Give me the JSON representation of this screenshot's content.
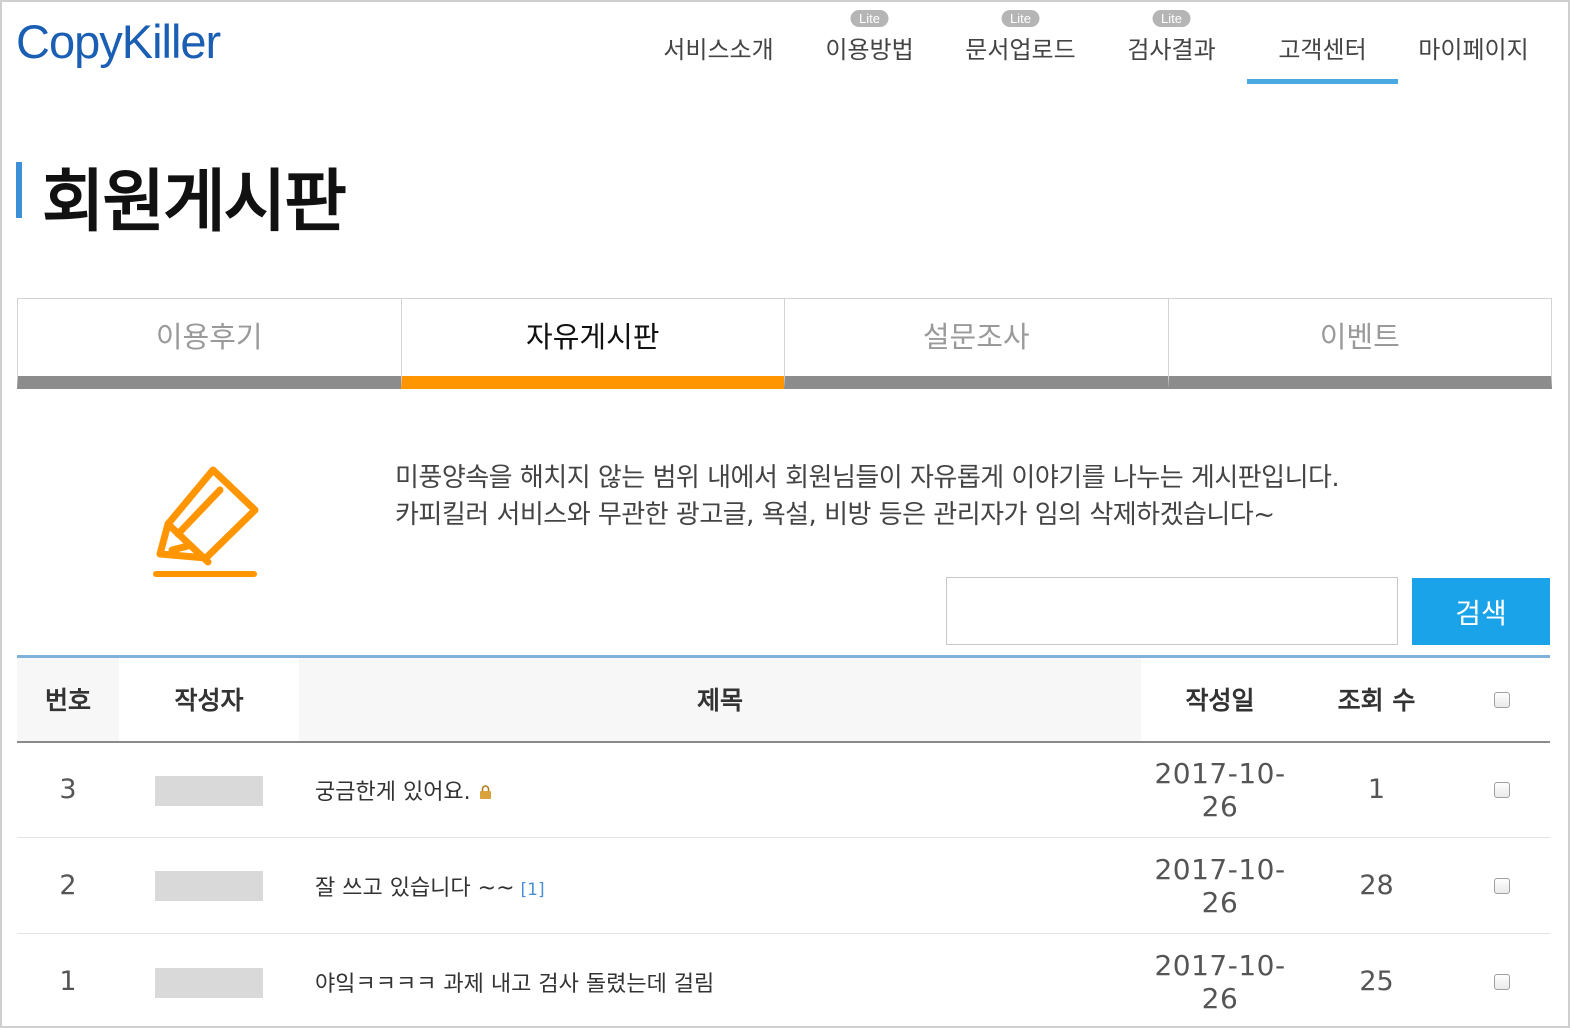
{
  "header": {
    "logo": "CopyKiller",
    "nav": [
      {
        "label": "서비스소개",
        "badge": ""
      },
      {
        "label": "이용방법",
        "badge": "Lite"
      },
      {
        "label": "문서업로드",
        "badge": "Lite"
      },
      {
        "label": "검사결과",
        "badge": "Lite"
      },
      {
        "label": "고객센터",
        "badge": "",
        "active": true
      },
      {
        "label": "마이페이지",
        "badge": ""
      }
    ],
    "accent_color": "#49a9e0"
  },
  "page": {
    "title": "회원게시판"
  },
  "tabs": [
    {
      "label": "이용후기"
    },
    {
      "label": "자유게시판",
      "active": true
    },
    {
      "label": "설문조사"
    },
    {
      "label": "이벤트"
    }
  ],
  "intro": {
    "icon": "pencil-icon",
    "line1": "미풍양속을 해치지 않는 범위 내에서 회원님들이 자유롭게 이야기를 나누는 게시판입니다.",
    "line2": "카피킬러 서비스와 무관한 광고글, 욕설, 비방 등은 관리자가 임의 삭제하겠습니다~"
  },
  "search": {
    "value": "",
    "placeholder": "",
    "button_label": "검색"
  },
  "board": {
    "columns": {
      "no": "번호",
      "author": "작성자",
      "subject": "제목",
      "date": "작성일",
      "views": "조회 수"
    },
    "rows": [
      {
        "no": "3",
        "subject": "궁금한게 있어요.",
        "reply": "",
        "locked": true,
        "date": "2017-10-26",
        "views": "1"
      },
      {
        "no": "2",
        "subject": "잘 쓰고 있습니다 ~~",
        "reply": "[1]",
        "locked": false,
        "date": "2017-10-26",
        "views": "28"
      },
      {
        "no": "1",
        "subject": "야잌ㅋㅋㅋㅋ 과제 내고 검사 돌렸는데 걸림",
        "reply": "",
        "locked": false,
        "date": "2017-10-26",
        "views": "25"
      }
    ]
  },
  "colors": {
    "tab_active": "#ff9500",
    "search_button": "#1aa3e8",
    "title_bar": "#3d8fd6"
  }
}
